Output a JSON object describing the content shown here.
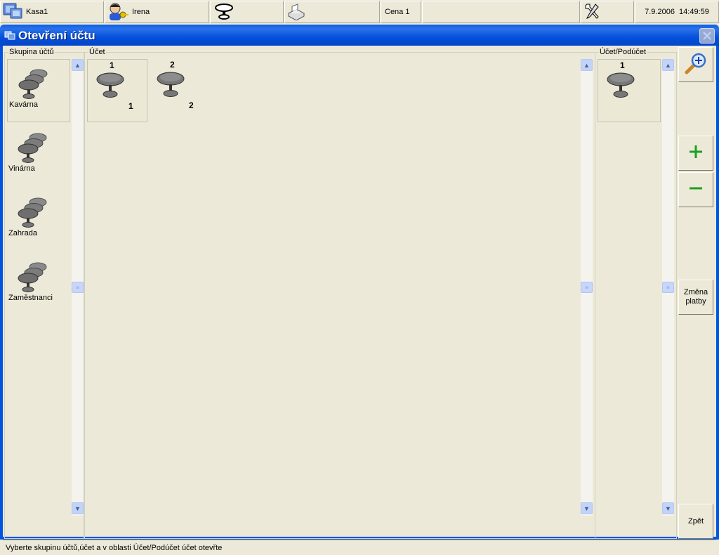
{
  "topbar": {
    "cashier": "Kasa1",
    "user": "Irena",
    "price": "Cena 1",
    "datetime": "7.9.2006  14:49:59"
  },
  "window": {
    "title": "Otevření účtu"
  },
  "groups": {
    "legend": "Skupina účtů",
    "items": [
      {
        "label": "Kavárna"
      },
      {
        "label": "Vinárna"
      },
      {
        "label": "Zahrada"
      },
      {
        "label": "Zaměstnanci"
      }
    ]
  },
  "accounts": {
    "legend": "Účet",
    "items": [
      {
        "top": "1",
        "bottom": "1"
      },
      {
        "top": "2",
        "bottom": "2"
      }
    ]
  },
  "subaccounts": {
    "legend": "Účet/Podúčet",
    "items": [
      {
        "top": "1"
      }
    ]
  },
  "buttons": {
    "zoom_icon": "magnifier-plus-icon",
    "plus_icon": "plus-icon",
    "minus_icon": "minus-icon",
    "change_payment": "Změna platby",
    "back": "Zpět"
  },
  "status": {
    "text": "Vyberte skupinu účtů,účet a v oblasti Účet/Podúčet účet otevřte"
  },
  "colors": {
    "accent": "#0054e3",
    "plus": "#1e9e1e",
    "minus": "#1e9e1e"
  }
}
